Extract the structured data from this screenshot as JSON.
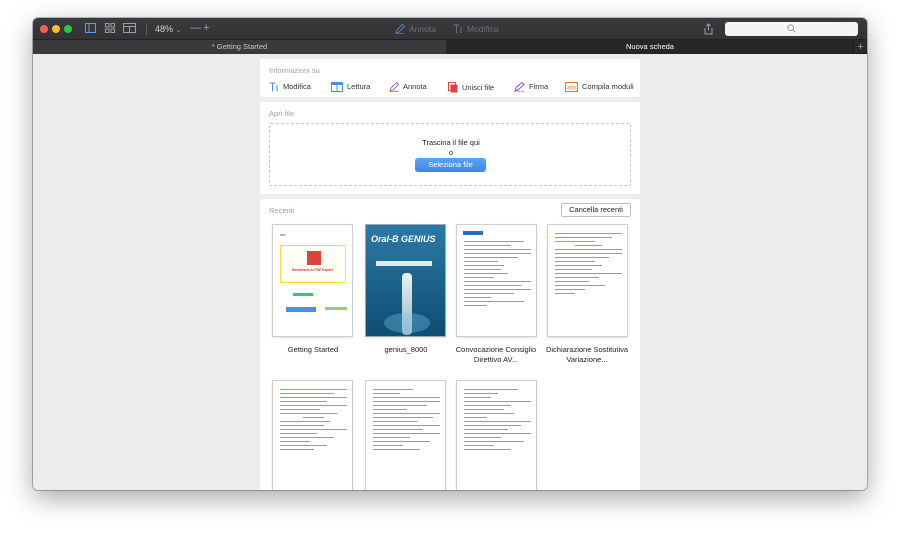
{
  "toolbar": {
    "zoom": "48%",
    "annotate_label": "Annota",
    "edit_label": "Modifica",
    "icons": [
      "sidebar-icon",
      "grid-icon",
      "page-layout-icon",
      "chevron-down-icon",
      "zoom-out-icon",
      "zoom-in-icon",
      "pen-icon",
      "text-edit-icon",
      "share-icon",
      "search-icon"
    ]
  },
  "tabs": [
    {
      "label": "* Getting Started"
    },
    {
      "label": "Nuova scheda"
    }
  ],
  "info": {
    "heading": "Informazioni su",
    "items": [
      {
        "label": "Modifica",
        "icon": "text-edit-icon"
      },
      {
        "label": "Lettura",
        "icon": "reading-icon"
      },
      {
        "label": "Annota",
        "icon": "pen-icon"
      },
      {
        "label": "Unisci file",
        "icon": "merge-files-icon"
      },
      {
        "label": "Firma",
        "icon": "signature-icon"
      },
      {
        "label": "Compila moduli",
        "icon": "form-fill-icon"
      }
    ]
  },
  "open": {
    "heading": "Apri file",
    "drop_text": "Trascina il file qui",
    "or_text": "o",
    "select_label": "Seleziona file"
  },
  "recent": {
    "heading": "Recenti",
    "clear_label": "Cancella recenti",
    "files": [
      {
        "name": "Getting Started",
        "thumb_text": "Benvenuto in PDF Expert"
      },
      {
        "name": "genius_8000",
        "thumb_text": "Oral-B GENIUS"
      },
      {
        "name": "Convocazione Consiglio Direttivo AV..."
      },
      {
        "name": "Dichiarazione Sostitutiva Variazione..."
      },
      {
        "name": ""
      },
      {
        "name": ""
      },
      {
        "name": ""
      }
    ]
  },
  "colors": {
    "accent": "#3a86e8",
    "titlebar": "#363638",
    "tab_active": "#262627",
    "close": "#fc5f57",
    "minimize": "#fdbc2e",
    "maximize": "#28c841"
  }
}
